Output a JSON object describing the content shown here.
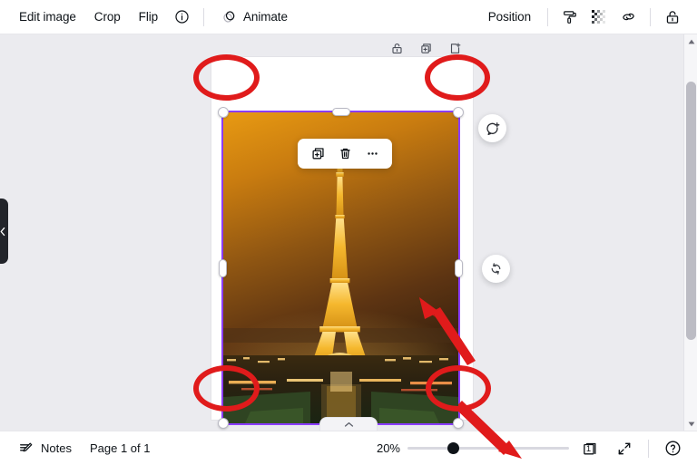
{
  "toolbar": {
    "left_items": [
      {
        "label": "Edit image",
        "name": "edit-image-button"
      },
      {
        "label": "Crop",
        "name": "crop-button"
      },
      {
        "label": "Flip",
        "name": "flip-button"
      }
    ],
    "info_icon": "info-icon",
    "animate_label": "Animate",
    "animate_icon": "animate-icon",
    "position_label": "Position",
    "right_icons": [
      {
        "name": "paint-roller-icon"
      },
      {
        "name": "transparency-icon"
      },
      {
        "name": "link-icon"
      },
      {
        "name": "lock-open-icon"
      }
    ]
  },
  "page_tools": [
    {
      "name": "lock-page-icon"
    },
    {
      "name": "duplicate-page-icon"
    },
    {
      "name": "add-page-icon"
    }
  ],
  "float_bar": [
    {
      "name": "duplicate-icon"
    },
    {
      "name": "delete-icon"
    },
    {
      "name": "more-options-icon"
    }
  ],
  "side_buttons": {
    "comment": "add-comment-icon",
    "rotate": "rotate-icon"
  },
  "panel_tab_icon": "chevron-left-icon",
  "collapse_tab_icon": "chevron-up-icon",
  "image": {
    "alt": "Eiffel Tower illuminated at night",
    "selection_color": "#8b3dff"
  },
  "bottombar": {
    "notes_label": "Notes",
    "notes_icon": "notes-icon",
    "page_indicator": "Page 1 of 1",
    "zoom_level": "20%",
    "page_count": "1",
    "page_count_icon": "page-count-icon",
    "fullscreen_icon": "expand-icon",
    "help_icon": "help-icon"
  },
  "annotations": {
    "color": "#e01b1b",
    "circles": [
      {
        "name": "annotation-circle-top-left"
      },
      {
        "name": "annotation-circle-top-right"
      },
      {
        "name": "annotation-circle-bottom-left"
      },
      {
        "name": "annotation-circle-bottom-right"
      }
    ],
    "arrows": [
      {
        "name": "annotation-arrow-to-image"
      },
      {
        "name": "annotation-arrow-to-zoom-slider"
      }
    ]
  },
  "scrollbars": {
    "vertical": "vertical-scrollbar",
    "horizontal": "horizontal-scrollbar"
  }
}
